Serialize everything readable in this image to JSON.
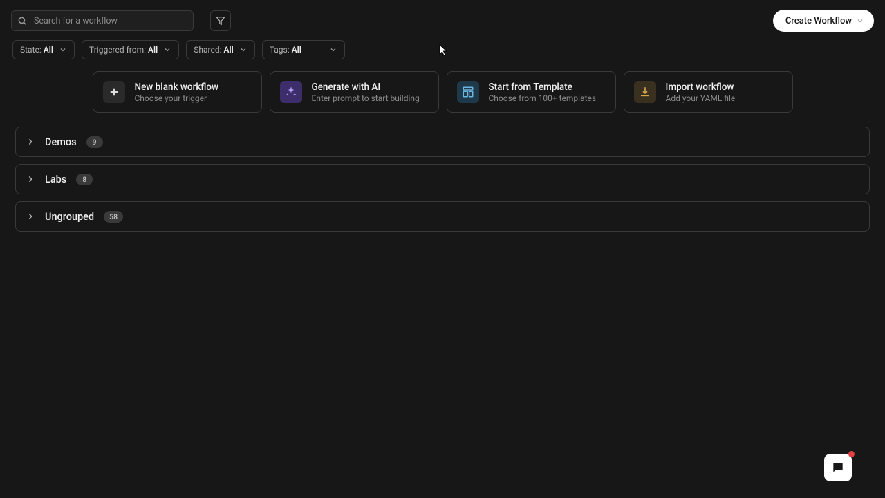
{
  "search": {
    "placeholder": "Search for a workflow"
  },
  "createButton": {
    "label": "Create Workflow"
  },
  "filters": {
    "state": {
      "label": "State:",
      "value": "All"
    },
    "triggered": {
      "label": "Triggered from:",
      "value": "All"
    },
    "shared": {
      "label": "Shared:",
      "value": "All"
    },
    "tags": {
      "label": "Tags:",
      "value": "All"
    }
  },
  "cards": {
    "blank": {
      "title": "New blank workflow",
      "sub": "Choose your trigger"
    },
    "ai": {
      "title": "Generate with AI",
      "sub": "Enter prompt to start building"
    },
    "template": {
      "title": "Start from Template",
      "sub": "Choose from 100+ templates"
    },
    "import": {
      "title": "Import workflow",
      "sub": "Add your YAML file"
    }
  },
  "groups": [
    {
      "name": "Demos",
      "count": "9"
    },
    {
      "name": "Labs",
      "count": "8"
    },
    {
      "name": "Ungrouped",
      "count": "58"
    }
  ]
}
